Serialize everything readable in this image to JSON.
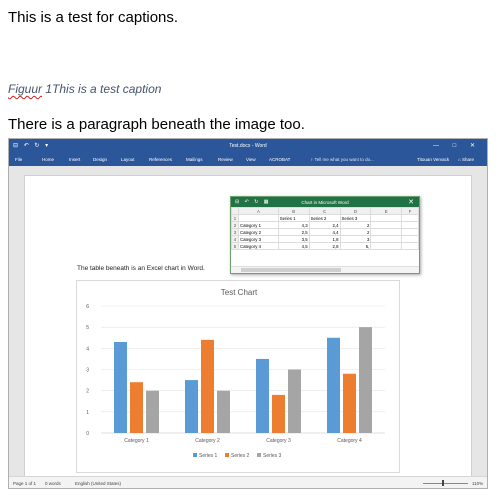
{
  "document": {
    "line1": "This is a test for captions.",
    "caption_label": "Figuur",
    "caption_number": "1",
    "caption_text": "This is a test caption",
    "line2": "There is a paragraph beneath the image too."
  },
  "word": {
    "quick_access": "⊟ ↶ ↻ ▾",
    "title": "Test.docx - Word",
    "window_controls": "— □ ✕",
    "tabs": [
      "File",
      "Home",
      "Insert",
      "Design",
      "Layout",
      "References",
      "Mailings",
      "Review",
      "View",
      "ACROBAT"
    ],
    "tell_me": "♀ Tell me what you want to do...",
    "user": "Titouan Vervack",
    "share": "⌂ Share",
    "body_text": "The table beneath is an Excel chart in Word.",
    "status": {
      "page": "Page 1 of 1",
      "words": "0 words",
      "language": "English (United States)",
      "zoom": "110%",
      "zoom_fraction": 0.45
    }
  },
  "excel": {
    "toolbar_icons": "⊟ ↶ ↻ ▦",
    "title": "Chart in Microsoft Word",
    "close": "✕",
    "columns": [
      "",
      "A",
      "B",
      "C",
      "D",
      "E",
      "F"
    ],
    "rows": [
      {
        "n": "1",
        "cells": [
          "",
          "Series 1",
          "Series 2",
          "Series 3",
          "",
          ""
        ]
      },
      {
        "n": "2",
        "cells": [
          "Category 1",
          "4,3",
          "2,4",
          "2",
          "",
          ""
        ]
      },
      {
        "n": "3",
        "cells": [
          "Category 2",
          "2,5",
          "4,4",
          "2",
          "",
          ""
        ]
      },
      {
        "n": "4",
        "cells": [
          "Category 3",
          "3,5",
          "1,8",
          "3",
          "",
          ""
        ]
      },
      {
        "n": "5",
        "cells": [
          "Category 4",
          "4,5",
          "2,8",
          "5,",
          "",
          ""
        ]
      }
    ]
  },
  "chart_data": {
    "type": "bar",
    "title": "Test Chart",
    "categories": [
      "Category 1",
      "Category 2",
      "Category 3",
      "Category 4"
    ],
    "series": [
      {
        "name": "Series 1",
        "values": [
          4.3,
          2.5,
          3.5,
          4.5
        ],
        "color": "#5b9bd5"
      },
      {
        "name": "Series 2",
        "values": [
          2.4,
          4.4,
          1.8,
          2.8
        ],
        "color": "#ed7d31"
      },
      {
        "name": "Series 3",
        "values": [
          2,
          2,
          3,
          5
        ],
        "color": "#a5a5a5"
      }
    ],
    "ylim": [
      0,
      6
    ],
    "yticks": [
      "0",
      "1",
      "2",
      "3",
      "4",
      "5",
      "6"
    ],
    "grid": true,
    "legend_position": "bottom"
  }
}
